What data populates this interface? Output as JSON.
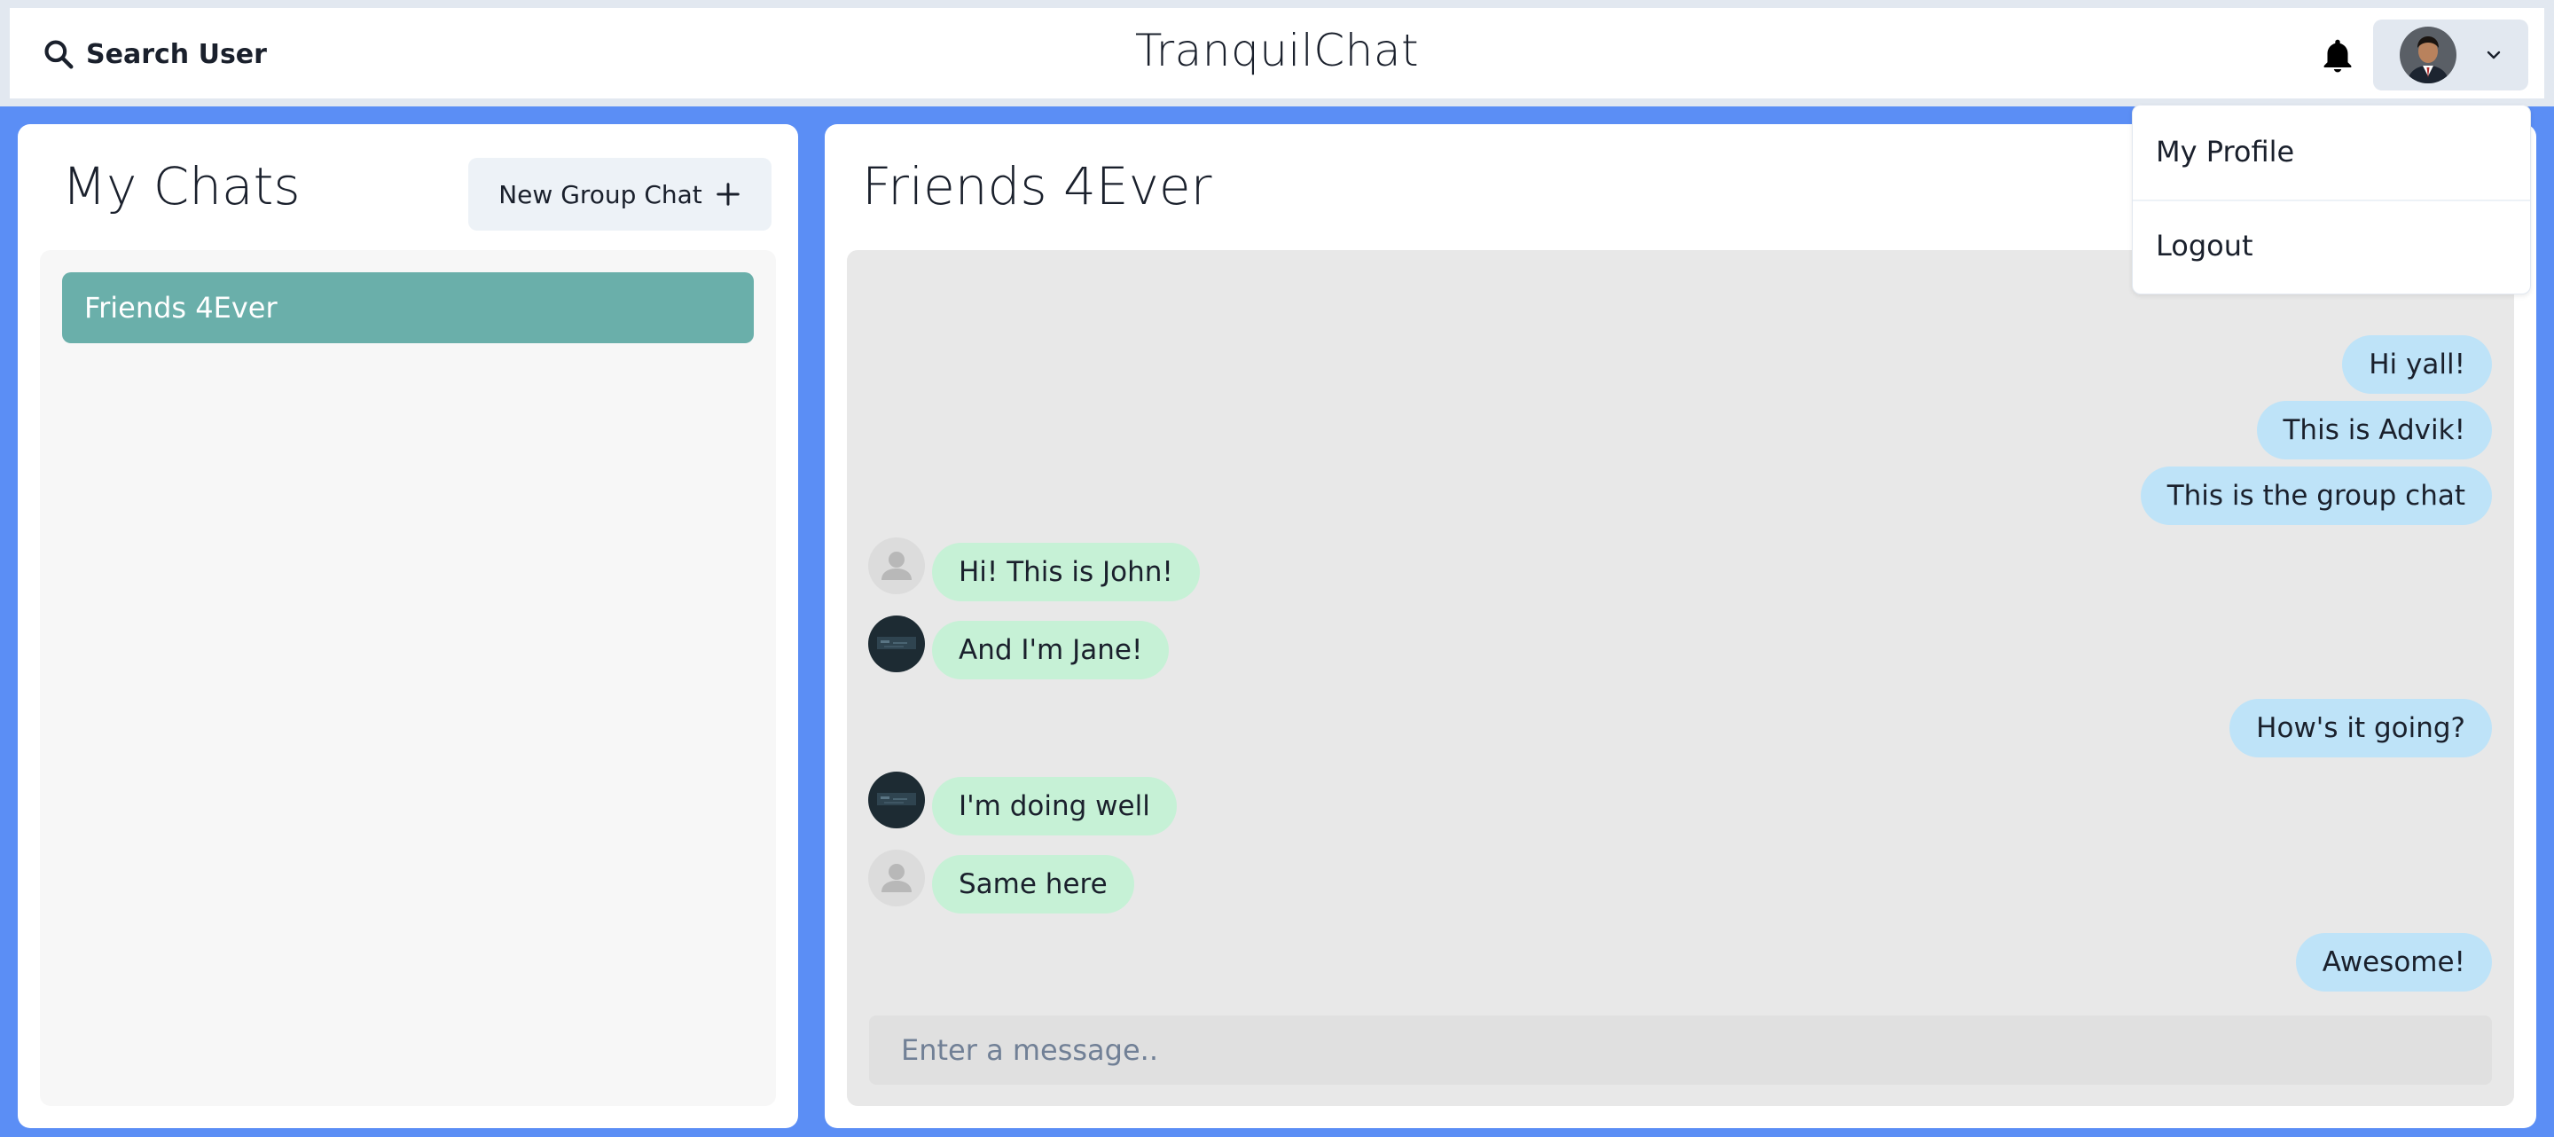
{
  "header": {
    "search_label": "Search User",
    "app_title": "TranquilChat",
    "icons": {
      "search": "search-icon",
      "bell": "bell-icon",
      "chevron": "chevron-down-icon"
    }
  },
  "profile_menu": {
    "items": [
      "My Profile",
      "Logout"
    ]
  },
  "sidebar": {
    "title": "My Chats",
    "new_group_label": "New Group Chat",
    "chats": [
      "Friends 4Ever"
    ]
  },
  "chat": {
    "title": "Friends 4Ever",
    "messages": [
      {
        "text": "Hi yall!",
        "direction": "outgoing"
      },
      {
        "text": "This is Advik!",
        "direction": "outgoing"
      },
      {
        "text": "This is the group chat",
        "direction": "outgoing"
      },
      {
        "text": "Hi! This is John!",
        "direction": "incoming",
        "avatar": "default-user-avatar"
      },
      {
        "text": "And I'm Jane!",
        "direction": "incoming",
        "avatar": "dark-photo-avatar"
      },
      {
        "text": "How's it going?",
        "direction": "outgoing"
      },
      {
        "text": "I'm doing well",
        "direction": "incoming",
        "avatar": "dark-photo-avatar"
      },
      {
        "text": "Same here",
        "direction": "incoming",
        "avatar": "default-user-avatar"
      },
      {
        "text": "Awesome!",
        "direction": "outgoing"
      }
    ],
    "input_placeholder": "Enter a message.."
  },
  "colors": {
    "background": "#5b8ef5",
    "selected_chat": "#6aafaa",
    "outgoing_bubble": "#bee3f8",
    "incoming_bubble": "#c6f1d6"
  }
}
